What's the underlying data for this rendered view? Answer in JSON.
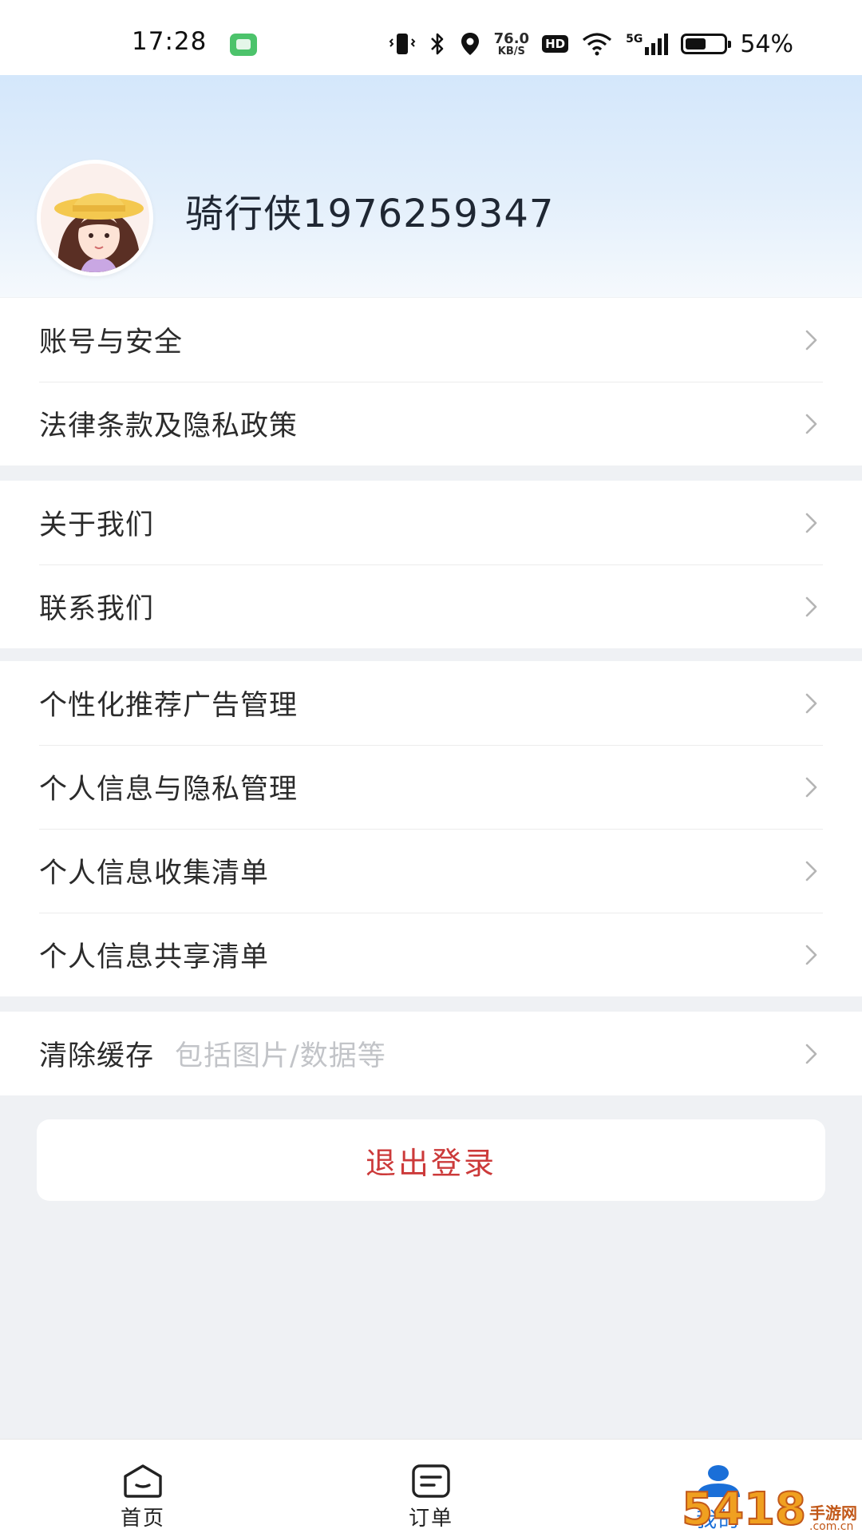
{
  "status_bar": {
    "time": "17:28",
    "speed_value": "76.0",
    "speed_unit": "KB/S",
    "hd": "HD",
    "network": "5G",
    "battery_percent": "54%",
    "battery_level": 0.54
  },
  "profile": {
    "username": "骑行侠1976259347"
  },
  "menu": {
    "group1": [
      {
        "label": "账号与安全"
      },
      {
        "label": "法律条款及隐私政策"
      }
    ],
    "group2": [
      {
        "label": "关于我们"
      },
      {
        "label": "联系我们"
      }
    ],
    "group3": [
      {
        "label": "个性化推荐广告管理"
      },
      {
        "label": "个人信息与隐私管理"
      },
      {
        "label": "个人信息收集清单"
      },
      {
        "label": "个人信息共享清单"
      }
    ],
    "cache": {
      "label": "清除缓存",
      "hint": "包括图片/数据等"
    }
  },
  "logout": {
    "label": "退出登录"
  },
  "tabs": [
    {
      "label": "首页",
      "icon": "home-icon"
    },
    {
      "label": "订单",
      "icon": "order-icon"
    },
    {
      "label": "我的",
      "icon": "profile-icon"
    }
  ],
  "watermark": {
    "big": "5418",
    "small_top": "手游网",
    "small_bottom": ".com.cn"
  },
  "colors": {
    "accent": "#1a6fd8",
    "logout_text": "#cc3a3a",
    "background": "#eff1f4"
  }
}
